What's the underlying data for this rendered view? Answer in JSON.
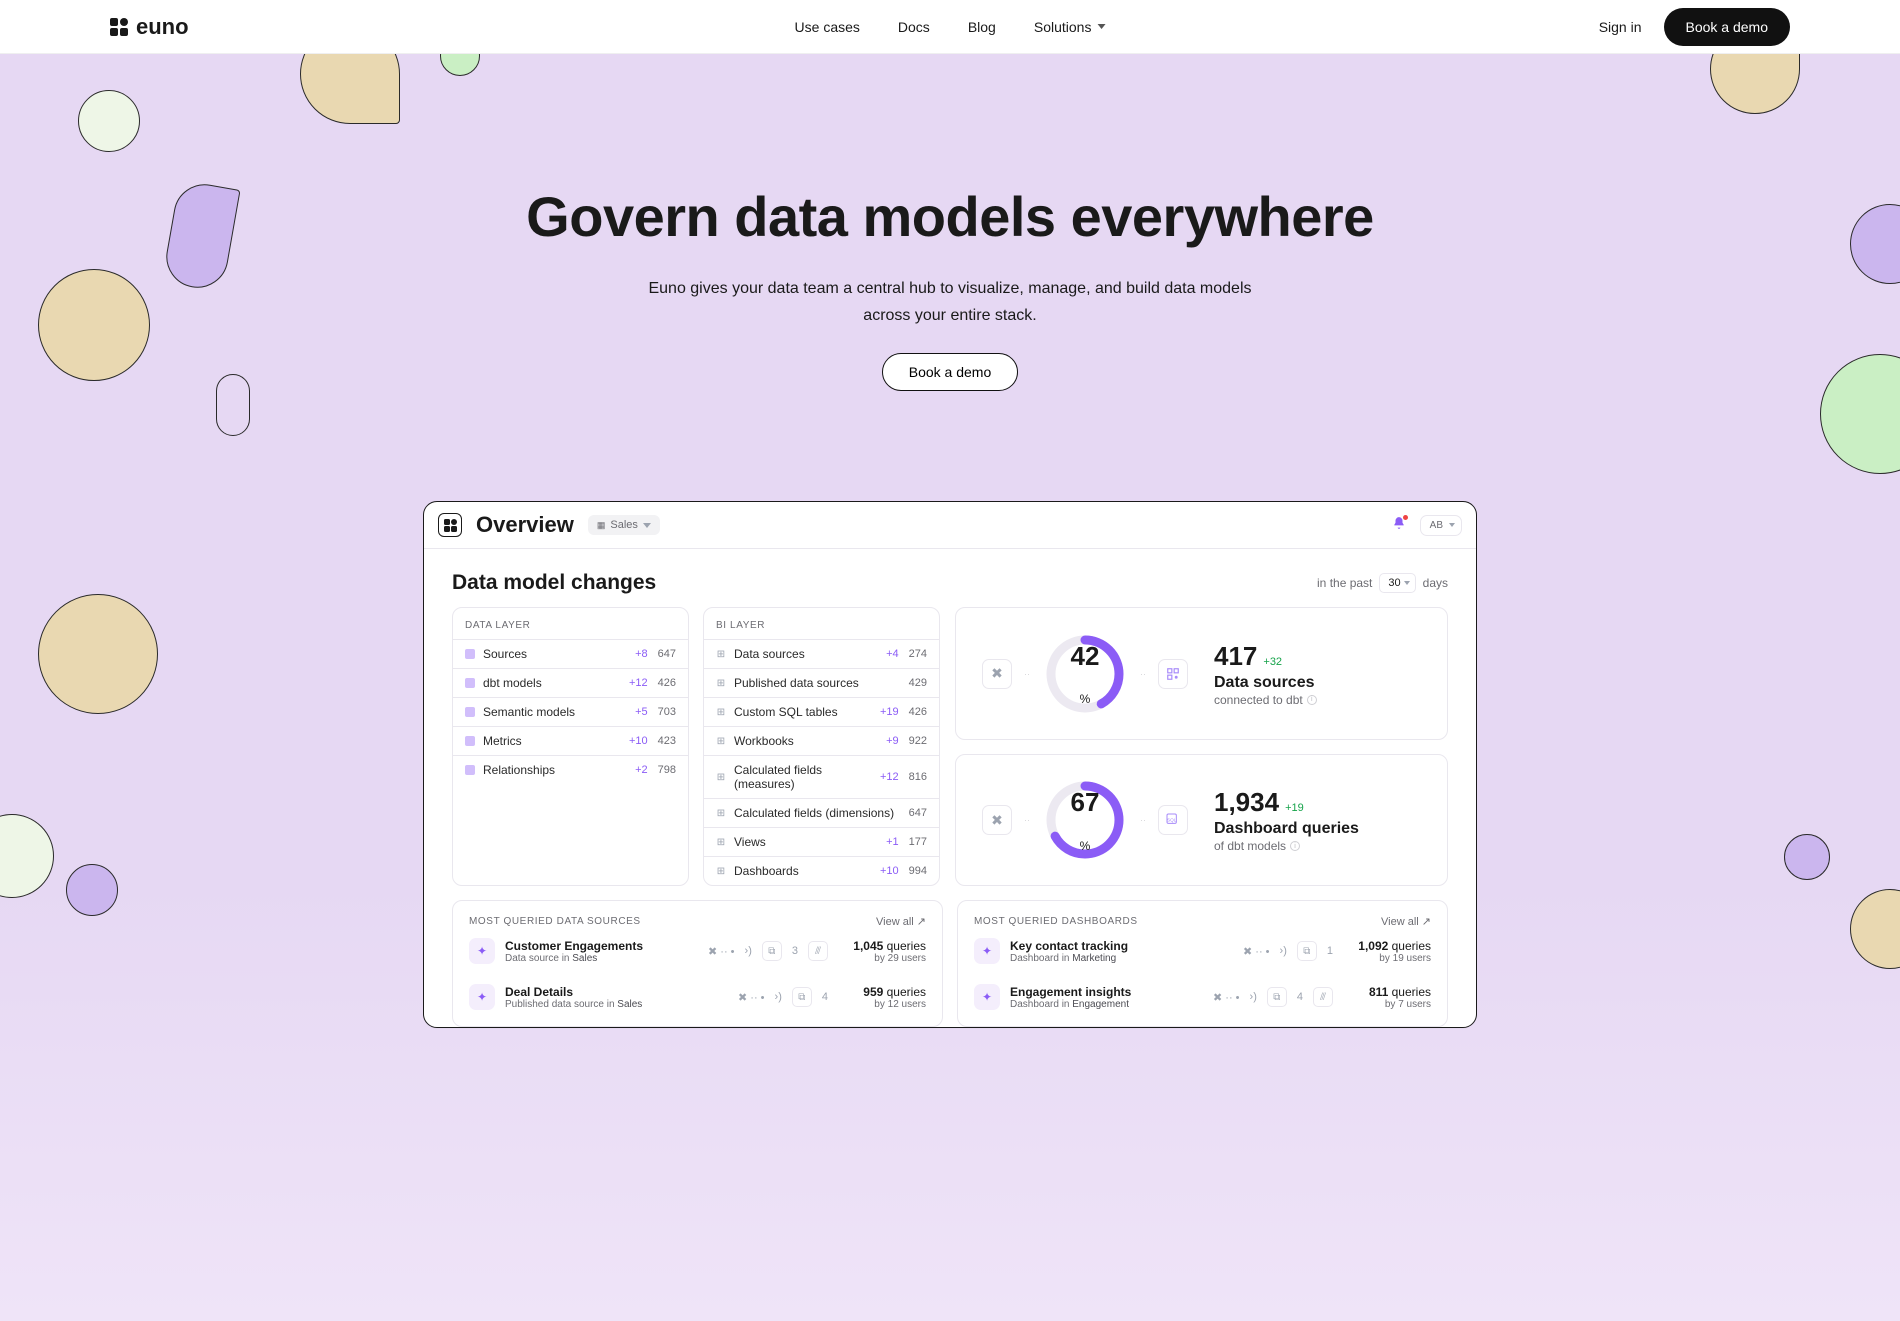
{
  "nav": {
    "brand": "euno",
    "items": [
      "Use cases",
      "Docs",
      "Blog",
      "Solutions"
    ],
    "sign_in": "Sign in",
    "demo": "Book a demo"
  },
  "hero": {
    "title": "Govern data models everywhere",
    "subtitle": "Euno gives your data team a central hub to visualize, manage, and build data models across your entire stack.",
    "cta": "Book a demo"
  },
  "app": {
    "title": "Overview",
    "chip_label": "Sales",
    "avatar": "AB",
    "changes": {
      "title": "Data model changes",
      "meta_prefix": "in the past",
      "days_value": "30",
      "days_suffix": "days",
      "data_layer_label": "DATA LAYER",
      "bi_layer_label": "BI LAYER",
      "data_layer": [
        {
          "label": "Sources",
          "delta": "+8",
          "total": "647"
        },
        {
          "label": "dbt models",
          "delta": "+12",
          "total": "426"
        },
        {
          "label": "Semantic models",
          "delta": "+5",
          "total": "703"
        },
        {
          "label": "Metrics",
          "delta": "+10",
          "total": "423"
        },
        {
          "label": "Relationships",
          "delta": "+2",
          "total": "798"
        }
      ],
      "bi_layer": [
        {
          "label": "Data sources",
          "delta": "+4",
          "total": "274"
        },
        {
          "label": "Published data sources",
          "delta": "",
          "total": "429"
        },
        {
          "label": "Custom SQL tables",
          "delta": "+19",
          "total": "426"
        },
        {
          "label": "Workbooks",
          "delta": "+9",
          "total": "922"
        },
        {
          "label": "Calculated fields (measures)",
          "delta": "+12",
          "total": "816"
        },
        {
          "label": "Calculated fields (dimensions)",
          "delta": "",
          "total": "647"
        },
        {
          "label": "Views",
          "delta": "+1",
          "total": "177"
        },
        {
          "label": "Dashboards",
          "delta": "+10",
          "total": "994"
        }
      ]
    },
    "stats": [
      {
        "pct": "42",
        "right_icon": "grid",
        "big": "417",
        "delta_s": "+32",
        "line2": "Data sources",
        "line3": "connected to dbt"
      },
      {
        "pct": "67",
        "right_icon": "sql",
        "big": "1,934",
        "delta_s": "+19",
        "line2": "Dashboard queries",
        "line3": "of dbt models"
      }
    ],
    "most": {
      "view_all": "View all ↗",
      "ds_label": "MOST QUERIED DATA SOURCES",
      "db_label": "MOST QUERIED DASHBOARDS",
      "queries_word": "queries",
      "by_word": "by",
      "users_word": "users",
      "ds_rows": [
        {
          "title": "Customer Engagements",
          "sub_prefix": "Data source in ",
          "sub_em": "Sales",
          "cnt": "3",
          "q": "1,045",
          "u": "29"
        },
        {
          "title": "Deal Details",
          "sub_prefix": "Published data source in ",
          "sub_em": "Sales",
          "cnt": "4",
          "q": "959",
          "u": "12"
        }
      ],
      "db_rows": [
        {
          "title": "Key contact tracking",
          "sub_prefix": "Dashboard in ",
          "sub_em": "Marketing",
          "cnt": "1",
          "q": "1,092",
          "u": "19"
        },
        {
          "title": "Engagement insights",
          "sub_prefix": "Dashboard in ",
          "sub_em": "Engagement",
          "cnt": "4",
          "q": "811",
          "u": "7"
        }
      ]
    }
  }
}
